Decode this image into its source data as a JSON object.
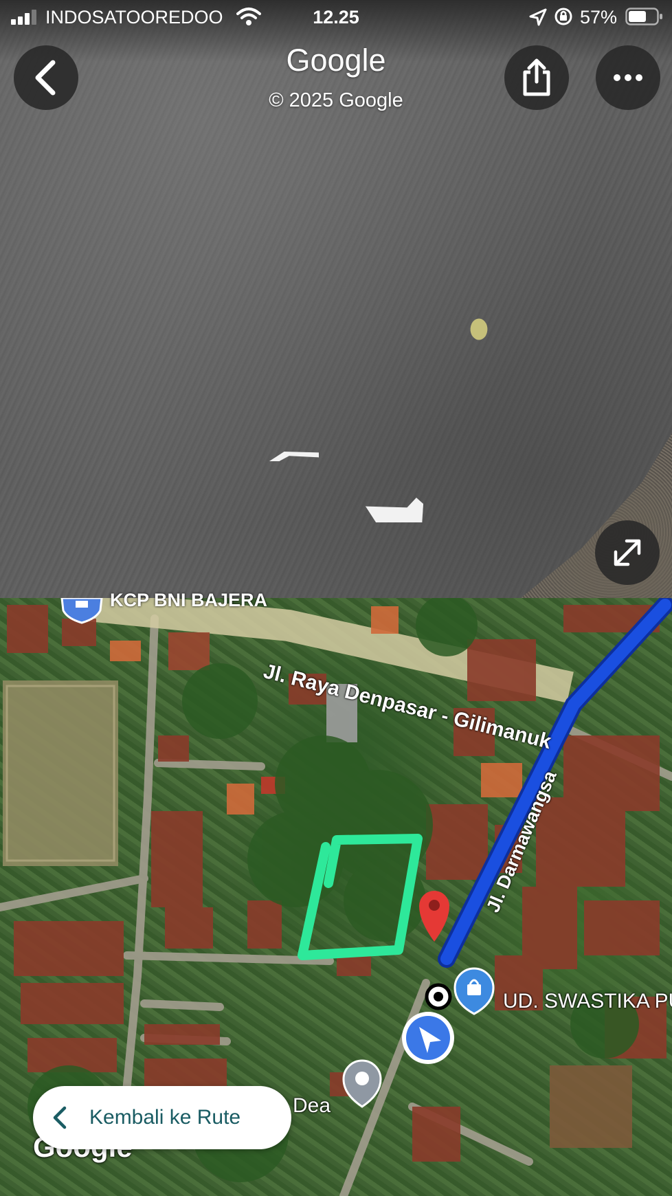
{
  "status_bar": {
    "carrier": "INDOSATOOREDOO",
    "time": "12.25",
    "battery_percent": "57%",
    "icons": [
      "signal-bars-icon",
      "wifi-icon",
      "location-arrow-icon",
      "orientation-lock-icon",
      "battery-icon"
    ]
  },
  "street_view": {
    "title": "Google",
    "copyright": "© 2025 Google",
    "buttons": {
      "back": "chevron-left-icon",
      "share": "share-icon",
      "more": "more-horizontal-icon",
      "expand": "expand-icon"
    }
  },
  "map": {
    "road_labels": {
      "raya": "Jl. Raya Denpasar - Gilimanuk",
      "darmawangsa": "Jl. Darmawangsa",
      "corner": "Jl."
    },
    "poi": {
      "bni": "KCP BNI BAJERA",
      "swastika": "UD. SWASTIKA PU",
      "dea": "Dea"
    },
    "watermark": "Google",
    "route_color": "#1a4fe0",
    "highlight_color": "#2ee89a",
    "marker_color": "#e53935"
  },
  "back_to_route": {
    "label": "Kembali ke Rute"
  }
}
